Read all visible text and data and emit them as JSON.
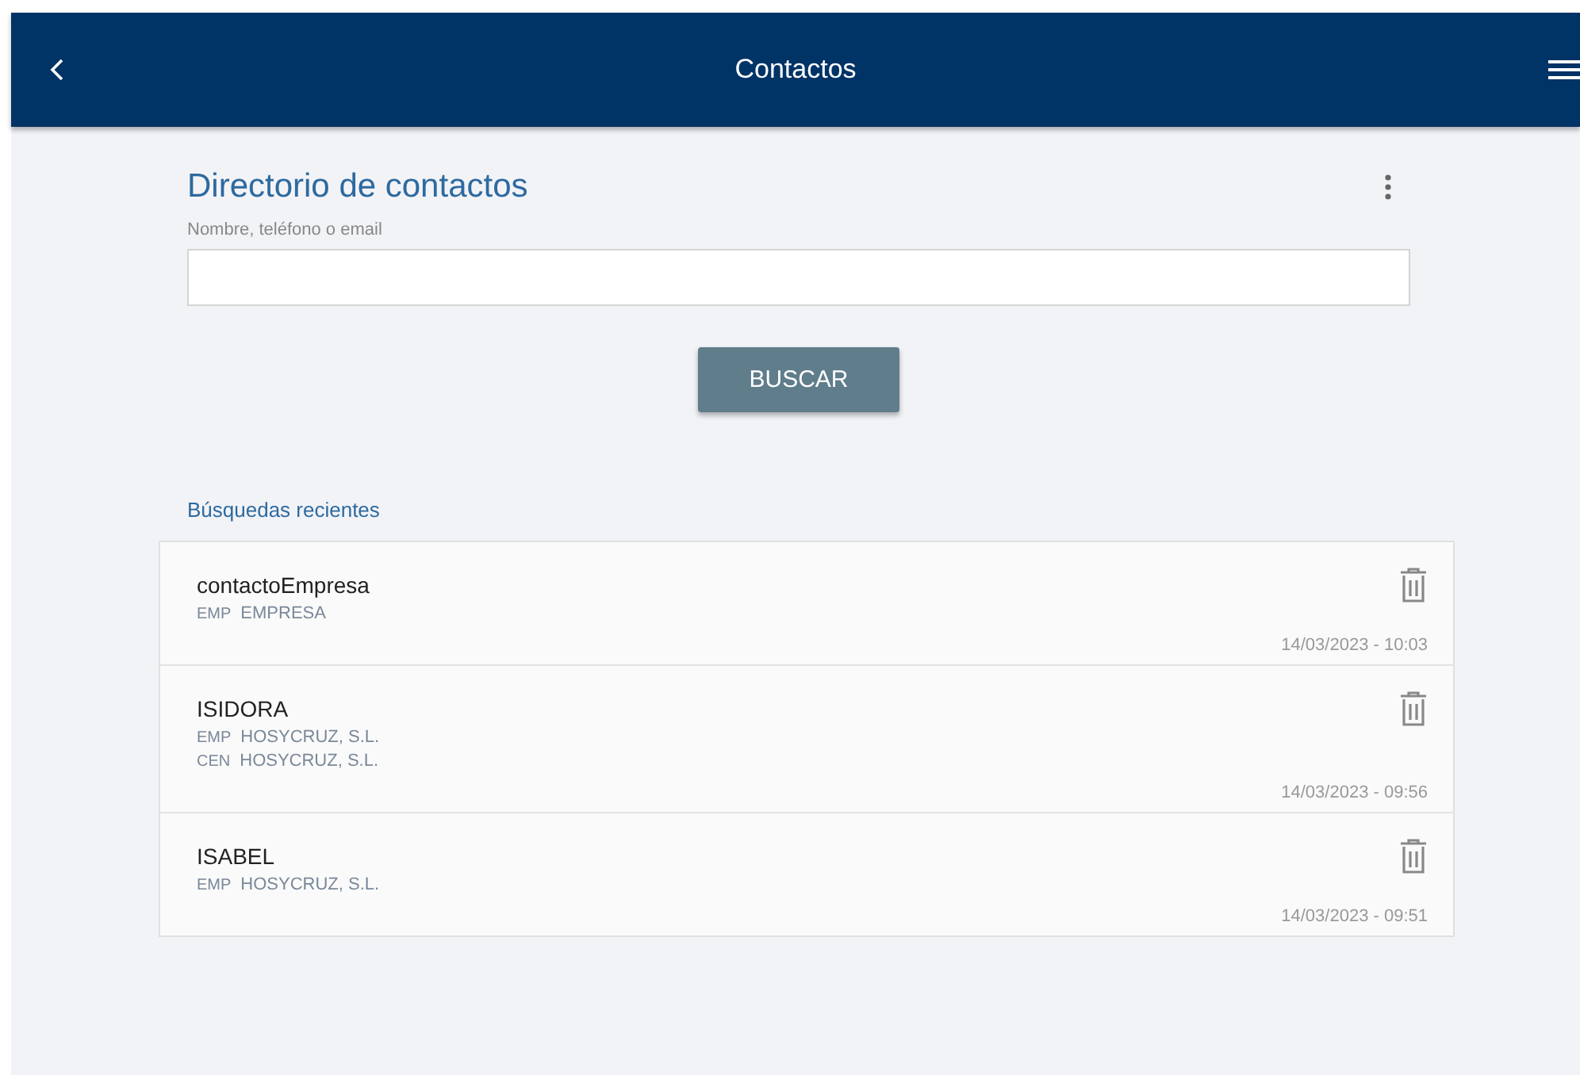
{
  "header": {
    "title": "Contactos"
  },
  "directory": {
    "title": "Directorio de contactos",
    "field_label": "Nombre, teléfono o email",
    "search_button": "BUSCAR"
  },
  "recent": {
    "heading": "Búsquedas recientes",
    "items": [
      {
        "name": "contactoEmpresa",
        "tags": [
          {
            "code": "EMP",
            "value": "EMPRESA"
          }
        ],
        "timestamp": "14/03/2023 - 10:03"
      },
      {
        "name": "ISIDORA",
        "tags": [
          {
            "code": "EMP",
            "value": "HOSYCRUZ, S.L."
          },
          {
            "code": "CEN",
            "value": "HOSYCRUZ, S.L."
          }
        ],
        "timestamp": "14/03/2023 - 09:56"
      },
      {
        "name": "ISABEL",
        "tags": [
          {
            "code": "EMP",
            "value": "HOSYCRUZ, S.L."
          }
        ],
        "timestamp": "14/03/2023 - 09:51"
      }
    ]
  }
}
